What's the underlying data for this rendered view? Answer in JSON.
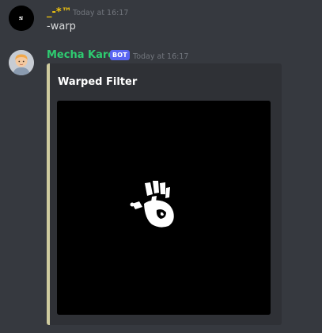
{
  "messages": [
    {
      "username": "_-*™",
      "timestamp": "Today at 16:17",
      "content": "-warp"
    },
    {
      "username": "Mecha Karen",
      "bot_tag": "BOT",
      "timestamp": "Today at 16:17",
      "embed": {
        "title": "Warped Filter"
      }
    }
  ],
  "colors": {
    "background": "#36393f",
    "embed_background": "#2f3136",
    "embed_accent": "#cfcb9f",
    "username_user": "#f1c40f",
    "username_bot": "#2ecc71",
    "bot_tag": "#5865f2",
    "timestamp": "#72767d"
  }
}
